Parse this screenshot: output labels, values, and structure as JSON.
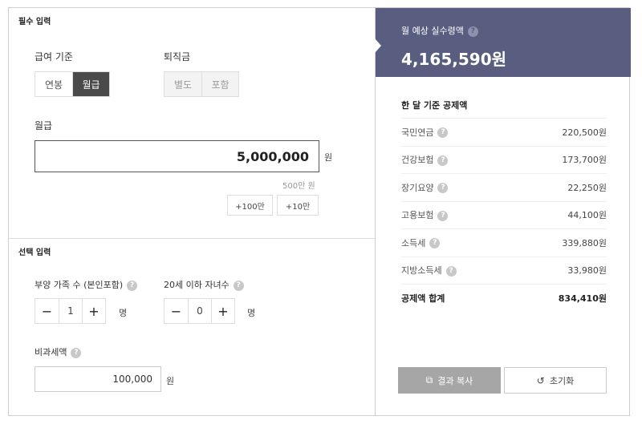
{
  "required": {
    "section_title": "필수 입력",
    "pay_basis": {
      "label": "급여 기준",
      "options": [
        "연봉",
        "월급"
      ],
      "selected": "월급"
    },
    "severance": {
      "label": "퇴직금",
      "options": [
        "별도",
        "포함"
      ]
    },
    "salary": {
      "label": "월급",
      "value": "5,000,000",
      "unit": "원",
      "hint": "500만 원"
    },
    "quick_add": [
      "+100만",
      "+10만"
    ]
  },
  "optional": {
    "section_title": "선택 입력",
    "dependents": {
      "label": "부양 가족 수 (본인포함)",
      "value": "1",
      "unit": "명"
    },
    "children": {
      "label": "20세 이하 자녀수",
      "value": "0",
      "unit": "명"
    },
    "nontax": {
      "label": "비과세액",
      "value": "100,000",
      "unit": "원"
    },
    "minus": "−",
    "plus": "+",
    "help": "?"
  },
  "result": {
    "title": "월 예상 실수령액",
    "amount": "4,165,590원",
    "deduction_title": "한 달 기준 공제액",
    "deductions": [
      {
        "name": "국민연금",
        "value": "220,500원"
      },
      {
        "name": "건강보험",
        "value": "173,700원"
      },
      {
        "name": "장기요양",
        "value": "22,250원"
      },
      {
        "name": "고용보험",
        "value": "44,100원"
      },
      {
        "name": "소득세",
        "value": "339,880원"
      },
      {
        "name": "지방소득세",
        "value": "33,980원"
      }
    ],
    "total": {
      "name": "공제액 합계",
      "value": "834,410원"
    },
    "copy_label": "결과 복사",
    "reset_label": "초기화"
  },
  "colors": {
    "header_bg": "#595e80",
    "active_toggle": "#4a4a4a",
    "copy_button": "#a6a6a6"
  }
}
